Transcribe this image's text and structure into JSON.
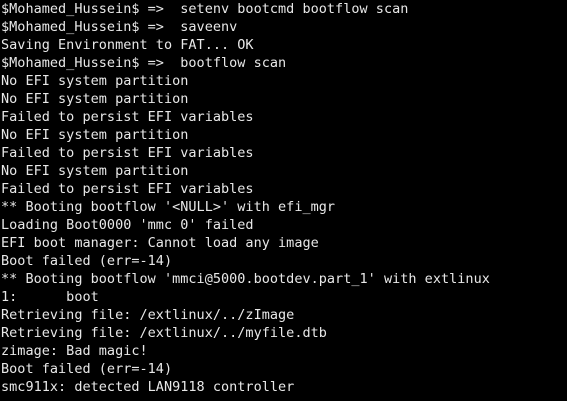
{
  "theme": {
    "background": "#000000",
    "foreground": "#e8e8e8"
  },
  "terminal": {
    "lines": [
      "$Mohamed_Hussein$ =>  setenv bootcmd bootflow scan",
      "$Mohamed_Hussein$ =>  saveenv",
      "Saving Environment to FAT... OK",
      "$Mohamed_Hussein$ =>  bootflow scan",
      "No EFI system partition",
      "No EFI system partition",
      "Failed to persist EFI variables",
      "No EFI system partition",
      "Failed to persist EFI variables",
      "No EFI system partition",
      "Failed to persist EFI variables",
      "** Booting bootflow '<NULL>' with efi_mgr",
      "Loading Boot0000 'mmc 0' failed",
      "EFI boot manager: Cannot load any image",
      "Boot failed (err=-14)",
      "** Booting bootflow 'mmci@5000.bootdev.part_1' with extlinux",
      "1:      boot",
      "Retrieving file: /extlinux/../zImage",
      "Retrieving file: /extlinux/../myfile.dtb",
      "zimage: Bad magic!",
      "Boot failed (err=-14)",
      "smc911x: detected LAN9118 controller"
    ]
  }
}
